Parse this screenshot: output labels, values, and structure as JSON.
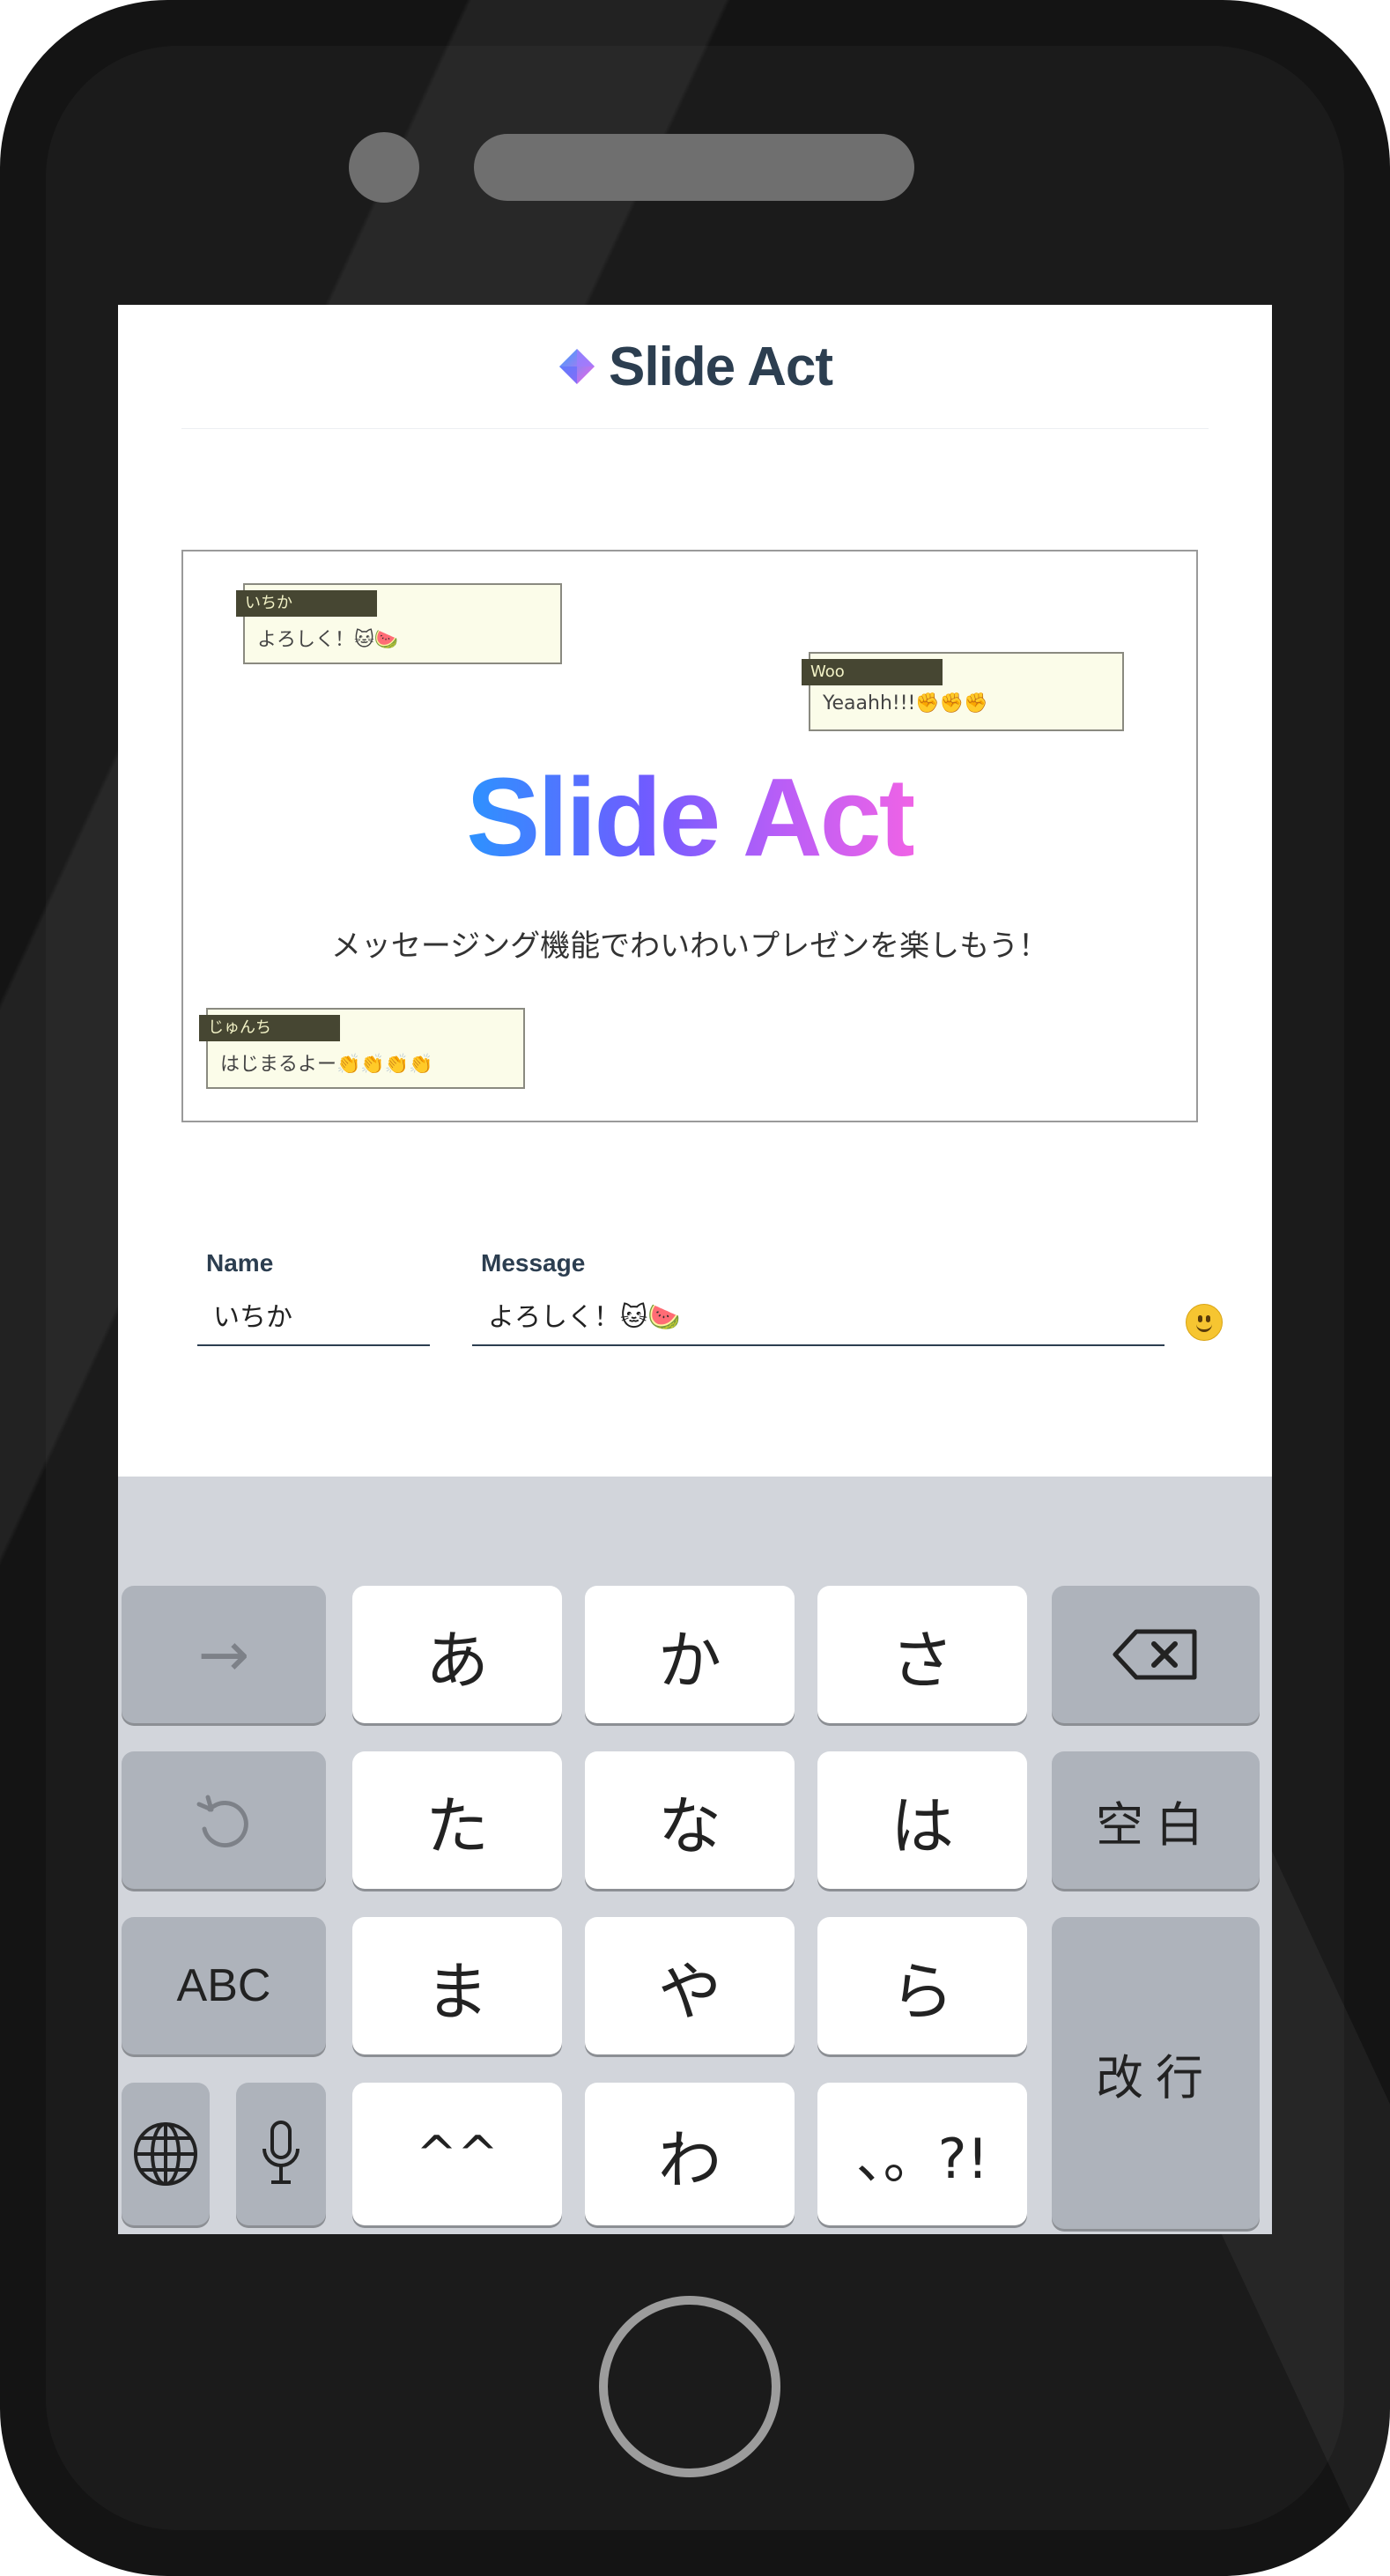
{
  "app": {
    "brand": "Slide Act"
  },
  "slide": {
    "title": "Slide Act",
    "subtitle": "メッセージング機能でわいわいプレゼンを楽しもう！",
    "comments": [
      {
        "name": "いちか",
        "message": "よろしく！🐱🍉"
      },
      {
        "name": "Woo",
        "message": "Yeaahh!!!✊✊✊"
      },
      {
        "name": "じゅんち",
        "message": "はじまるよー👏👏👏👏"
      }
    ]
  },
  "form": {
    "name_label": "Name",
    "name_value": "いちか",
    "message_label": "Message",
    "message_value": "よろしく！🐱🍉"
  },
  "keyboard": {
    "row1": [
      "→",
      "あ",
      "か",
      "さ"
    ],
    "row2": [
      "た",
      "な",
      "は",
      "空白"
    ],
    "row3": [
      "ABC",
      "ま",
      "や",
      "ら",
      "改行"
    ],
    "row4": [
      "^^",
      "わ",
      "、。?!"
    ]
  },
  "colors": {
    "brand_text": "#2c3e50",
    "gradient_start": "#2c93ff",
    "gradient_end": "#ef63e6",
    "bubble_bg": "#fbfce9",
    "bubble_label_bg": "#464632",
    "keyboard_bg": "#d2d5db"
  },
  "icons": [
    "logo-gem-icon",
    "emoji-smile-icon",
    "delete-icon",
    "undo-icon",
    "globe-icon",
    "microphone-icon"
  ]
}
